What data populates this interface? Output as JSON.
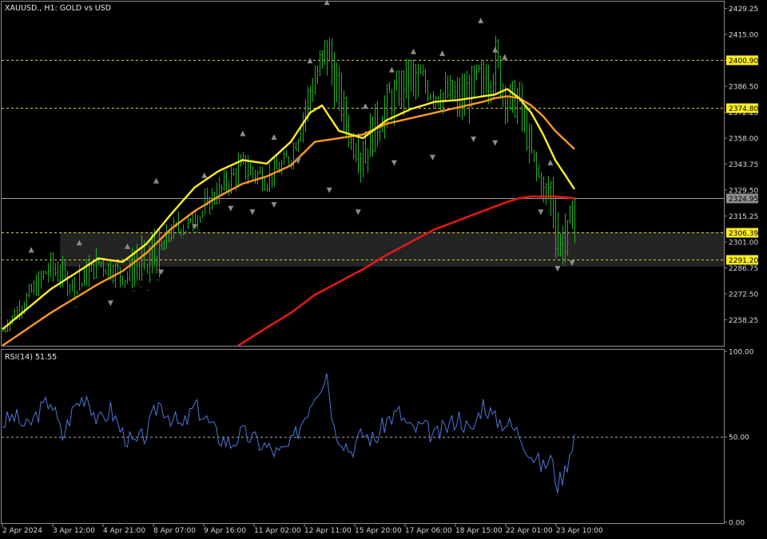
{
  "main_header": "XAUUSD., H1:  GOLD vs USD",
  "rsi_header": "RSI(14) 51.55",
  "colors": {
    "bg": "#000000",
    "candle": "#22b022",
    "ema_fast": "#ffee22",
    "ema_mid": "#ff9a1e",
    "ema_slow": "#e01818",
    "rsi": "#4f78d8",
    "level_line": "#d8c840",
    "zone": "#2a2a2a",
    "fractal": "#8c8c8c"
  },
  "chart_data": [
    {
      "type": "line",
      "symbol": "XAUUSD.",
      "timeframe": "H1",
      "description": "GOLD vs USD",
      "ylim": [
        2244.0,
        2433.0
      ],
      "y_ticks": [
        "2429.25",
        "2415.00",
        "2400.75",
        "2386.50",
        "2372.25",
        "2358.00",
        "2343.75",
        "2329.50",
        "2315.25",
        "2301.00",
        "2286.75",
        "2272.50",
        "2258.25"
      ],
      "x_tick_labels": [
        "2 Apr 2024",
        "3 Apr 12:00",
        "4 Apr 21:00",
        "8 Apr 07:00",
        "9 Apr 16:00",
        "11 Apr 02:00",
        "12 Apr 11:00",
        "15 Apr 20:00",
        "17 Apr 06:00",
        "18 Apr 15:00",
        "22 Apr 01:00",
        "23 Apr 10:00"
      ],
      "bar_index_range": [
        0,
        238
      ],
      "series": [
        {
          "role": "price_close",
          "x": [
            0,
            10,
            20,
            30,
            40,
            50,
            60,
            70,
            80,
            90,
            100,
            110,
            120,
            128,
            135,
            145,
            150,
            160,
            170,
            180,
            190,
            200,
            205,
            210,
            215,
            220,
            225,
            228,
            231,
            234,
            238
          ],
          "y": [
            2252,
            2270,
            2288,
            2272,
            2290,
            2283,
            2276,
            2306,
            2310,
            2328,
            2342,
            2335,
            2348,
            2385,
            2408,
            2356,
            2352,
            2378,
            2395,
            2383,
            2380,
            2392,
            2400,
            2378,
            2380,
            2348,
            2328,
            2332,
            2297,
            2296,
            2325
          ]
        },
        {
          "role": "high",
          "x": [
            0,
            20,
            40,
            50,
            60,
            70,
            80,
            90,
            100,
            110,
            120,
            128,
            133,
            135,
            145,
            150,
            160,
            170,
            180,
            190,
            200,
            205,
            210,
            215,
            220,
            225,
            230,
            238
          ],
          "y": [
            2260,
            2298,
            2303,
            2292,
            2330,
            2320,
            2333,
            2344,
            2358,
            2348,
            2356,
            2400,
            2412,
            2432,
            2372,
            2370,
            2390,
            2402,
            2400,
            2398,
            2405,
            2420,
            2400,
            2390,
            2368,
            2344,
            2340,
            2326
          ]
        },
        {
          "role": "low",
          "x": [
            0,
            20,
            40,
            50,
            60,
            70,
            80,
            90,
            100,
            110,
            120,
            128,
            133,
            135,
            145,
            150,
            160,
            170,
            180,
            190,
            200,
            205,
            210,
            215,
            220,
            225,
            230,
            238
          ],
          "y": [
            2248,
            2272,
            2280,
            2270,
            2290,
            2300,
            2316,
            2322,
            2328,
            2326,
            2336,
            2360,
            2376,
            2370,
            2345,
            2322,
            2352,
            2362,
            2368,
            2356,
            2364,
            2368,
            2360,
            2352,
            2334,
            2318,
            2288,
            2294
          ]
        },
        {
          "role": "ema_fast",
          "x": [
            0,
            20,
            40,
            50,
            60,
            70,
            80,
            90,
            100,
            110,
            120,
            128,
            133,
            140,
            150,
            160,
            170,
            180,
            190,
            200,
            205,
            210,
            215,
            220,
            225,
            230,
            238
          ],
          "y": [
            2253,
            2275,
            2292,
            2290,
            2300,
            2316,
            2331,
            2340,
            2346,
            2344,
            2356,
            2372,
            2376,
            2362,
            2358,
            2368,
            2374,
            2378,
            2379,
            2381,
            2382,
            2385,
            2380,
            2372,
            2360,
            2346,
            2330
          ]
        },
        {
          "role": "ema_mid",
          "x": [
            0,
            20,
            40,
            50,
            60,
            70,
            80,
            90,
            100,
            110,
            120,
            130,
            140,
            150,
            160,
            170,
            180,
            190,
            200,
            205,
            210,
            215,
            220,
            225,
            230,
            238
          ],
          "y": [
            2244,
            2262,
            2278,
            2285,
            2295,
            2308,
            2318,
            2326,
            2333,
            2337,
            2343,
            2356,
            2358,
            2360,
            2366,
            2369,
            2372,
            2375,
            2378,
            2380,
            2381,
            2380,
            2376,
            2370,
            2362,
            2352
          ]
        },
        {
          "role": "ema_slow",
          "x": [
            98,
            110,
            120,
            130,
            140,
            150,
            160,
            170,
            180,
            190,
            200,
            210,
            215,
            220,
            225,
            230,
            238
          ],
          "y": [
            2244,
            2254,
            2262,
            2272,
            2279,
            2286,
            2294,
            2301,
            2308,
            2313,
            2318,
            2323,
            2325,
            2326,
            2326,
            2326,
            2325
          ]
        }
      ],
      "horizontal_levels": [
        {
          "value": "2400.90",
          "style": "dashed",
          "tag_bg": "#ffee22"
        },
        {
          "value": "2374.80",
          "style": "dashed",
          "tag_bg": "#ffee22"
        },
        {
          "value": "2324.95",
          "style": "solid",
          "tag_bg": "#909090"
        },
        {
          "value": "2306.39",
          "style": "dashed",
          "tag_bg": "#ffee22"
        },
        {
          "value": "2291.20",
          "style": "dashed",
          "tag_bg": "#ffee22"
        }
      ],
      "zone": {
        "from_bar": 24,
        "to_bar": 238,
        "y_low": 2287.5,
        "y_high": 2306.4
      },
      "fractals": {
        "up": {
          "x": [
            12,
            32,
            52,
            64,
            84,
            100,
            113,
            128,
            135,
            151,
            162,
            171,
            183,
            199,
            205,
            209,
            228
          ],
          "y": [
            2296,
            2300,
            2298,
            2334,
            2337,
            2360,
            2358,
            2400,
            2432,
            2375,
            2395,
            2405,
            2404,
            2422,
            2406,
            2402,
            2344
          ]
        },
        "down": {
          "x": [
            45,
            66,
            80,
            95,
            104,
            113,
            123,
            136,
            148,
            163,
            179,
            196,
            205,
            224,
            231,
            237
          ],
          "y": [
            2268,
            2285,
            2310,
            2320,
            2318,
            2322,
            2346,
            2330,
            2318,
            2345,
            2348,
            2358,
            2356,
            2318,
            2287,
            2290
          ]
        }
      }
    },
    {
      "type": "line",
      "indicator": "RSI(14)",
      "last_value": 51.55,
      "ylim": [
        0,
        100
      ],
      "y_ticks": [
        "100.00",
        "50.00",
        "0.00"
      ],
      "levels": [
        50
      ],
      "series": [
        {
          "role": "rsi",
          "x": [
            0,
            5,
            10,
            15,
            20,
            25,
            30,
            35,
            40,
            45,
            50,
            55,
            60,
            65,
            70,
            75,
            80,
            85,
            90,
            95,
            100,
            105,
            110,
            115,
            120,
            125,
            130,
            133,
            135,
            138,
            145,
            150,
            155,
            160,
            165,
            170,
            175,
            180,
            185,
            190,
            195,
            200,
            205,
            210,
            215,
            220,
            225,
            228,
            231,
            234,
            238
          ],
          "y": [
            58,
            62,
            55,
            64,
            72,
            50,
            68,
            75,
            58,
            66,
            52,
            45,
            52,
            70,
            62,
            55,
            68,
            60,
            50,
            46,
            52,
            48,
            44,
            40,
            45,
            60,
            76,
            82,
            88,
            55,
            42,
            52,
            48,
            60,
            64,
            54,
            56,
            50,
            56,
            62,
            52,
            70,
            60,
            58,
            52,
            40,
            32,
            38,
            22,
            30,
            52
          ]
        }
      ]
    }
  ]
}
